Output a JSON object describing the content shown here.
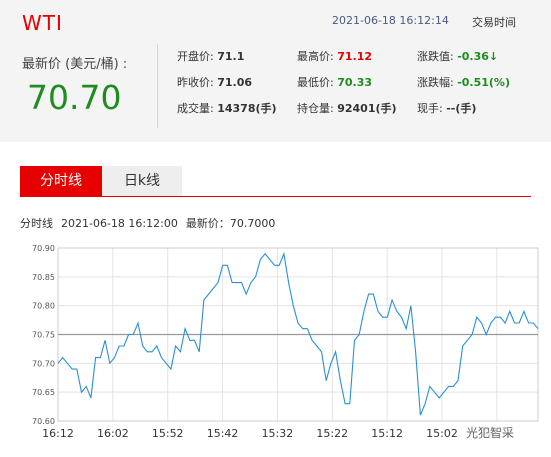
{
  "header": {
    "symbol": "WTI",
    "timestamp": "2021-06-18 16:12:14",
    "trading_time_label": "交易时间",
    "latest_label": "最新价 (美元/桶) :",
    "latest_value": "70.70"
  },
  "stats": [
    [
      {
        "label": "开盘价:",
        "value": "71.1",
        "color": "#333333"
      },
      {
        "label": "最高价:",
        "value": "71.12",
        "color": "#e60000"
      },
      {
        "label": "涨跌值:",
        "value": "-0.36↓",
        "color": "#1e8c1e"
      }
    ],
    [
      {
        "label": "昨收价:",
        "value": "71.06",
        "color": "#333333"
      },
      {
        "label": "最低价:",
        "value": "70.33",
        "color": "#1e8c1e"
      },
      {
        "label": "涨跌幅:",
        "value": "-0.51(%)",
        "color": "#1e8c1e"
      }
    ],
    [
      {
        "label": "成交量:",
        "value": "14378(手)",
        "color": "#333333"
      },
      {
        "label": "持仓量:",
        "value": "92401(手)",
        "color": "#333333"
      },
      {
        "label": "现手:",
        "value": "--(手)",
        "color": "#333333"
      }
    ]
  ],
  "tabs": [
    {
      "label": "分时线",
      "active": true
    },
    {
      "label": "日k线",
      "active": false
    }
  ],
  "caption": {
    "name": "分时线",
    "time": "2021-06-18 16:12:00",
    "latest": "最新价：70.7000"
  },
  "watermark": "光犯智采",
  "colors": {
    "accent": "#e60000",
    "down": "#1e8c1e",
    "line": "#2a8fd6",
    "reference": "#999999"
  },
  "chart_data": {
    "type": "line",
    "reference_value": 70.75,
    "ylim": [
      70.6,
      70.9
    ],
    "y_ticks": [
      "70.90",
      "70.85",
      "70.80",
      "70.75",
      "70.70",
      "70.65",
      "70.60"
    ],
    "x_ticks": [
      "16:12",
      "16:02",
      "15:52",
      "15:42",
      "15:32",
      "15:22",
      "15:12",
      "15:02",
      "14:52"
    ],
    "grid": true,
    "series": [
      {
        "values": [
          70.7,
          70.71,
          70.7,
          70.69,
          70.69,
          70.65,
          70.66,
          70.64,
          70.71,
          70.71,
          70.74,
          70.7,
          70.71,
          70.73,
          70.73,
          70.75,
          70.75,
          70.77,
          70.73,
          70.72,
          70.72,
          70.73,
          70.71,
          70.7,
          70.69,
          70.73,
          70.72,
          70.76,
          70.74,
          70.74,
          70.72,
          70.81,
          70.82,
          70.83,
          70.84,
          70.87,
          70.87,
          70.84,
          70.84,
          70.84,
          70.82,
          70.84,
          70.85,
          70.88,
          70.89,
          70.88,
          70.87,
          70.87,
          70.89,
          70.84,
          70.8,
          70.77,
          70.76,
          70.76,
          70.74,
          70.73,
          70.72,
          70.67,
          70.7,
          70.72,
          70.67,
          70.63,
          70.63,
          70.74,
          70.75,
          70.79,
          70.82,
          70.82,
          70.79,
          70.78,
          70.78,
          70.81,
          70.79,
          70.78,
          70.76,
          70.8,
          70.72,
          70.61,
          70.63,
          70.66,
          70.65,
          70.64,
          70.65,
          70.66,
          70.66,
          70.67,
          70.73,
          70.74,
          70.75,
          70.78,
          70.77,
          70.75,
          70.77,
          70.78,
          70.78,
          70.77,
          70.79,
          70.77,
          70.77,
          70.79,
          70.77,
          70.77,
          70.76
        ]
      }
    ]
  }
}
